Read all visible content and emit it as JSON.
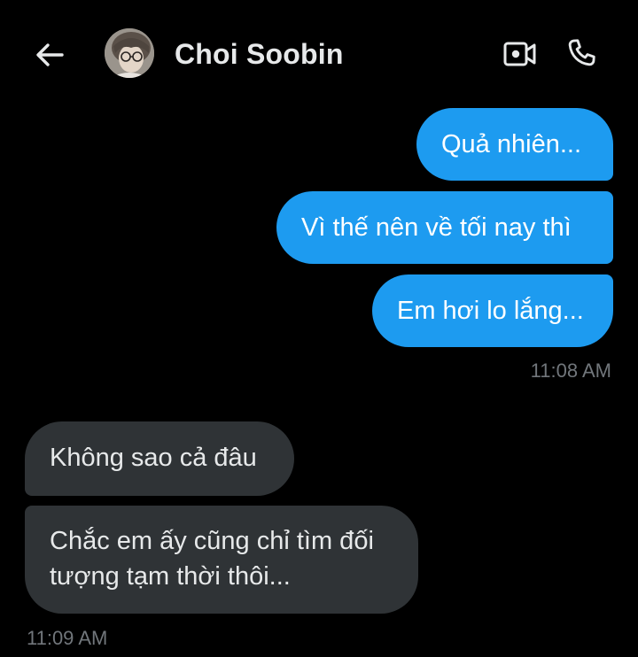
{
  "header": {
    "contact_name": "Choi Soobin",
    "back_icon": "arrow-left-icon",
    "video_icon": "video-call-icon",
    "call_icon": "phone-icon"
  },
  "messages": {
    "outgoing": [
      {
        "text": "Quả nhiên..."
      },
      {
        "text": "Vì thế nên về tối nay thì"
      },
      {
        "text": "Em hơi lo lắng..."
      }
    ],
    "outgoing_time": "11:08 AM",
    "incoming": [
      {
        "text": "Không sao cả đâu"
      },
      {
        "line1": "Chắc em ấy cũng chỉ tìm đối",
        "line2": "tượng tạm thời thôi..."
      }
    ],
    "incoming_time": "11:09 AM"
  },
  "colors": {
    "background": "#000000",
    "outgoing_bubble": "#1d9bf0",
    "incoming_bubble": "#2f3336",
    "timestamp": "#71767b"
  }
}
